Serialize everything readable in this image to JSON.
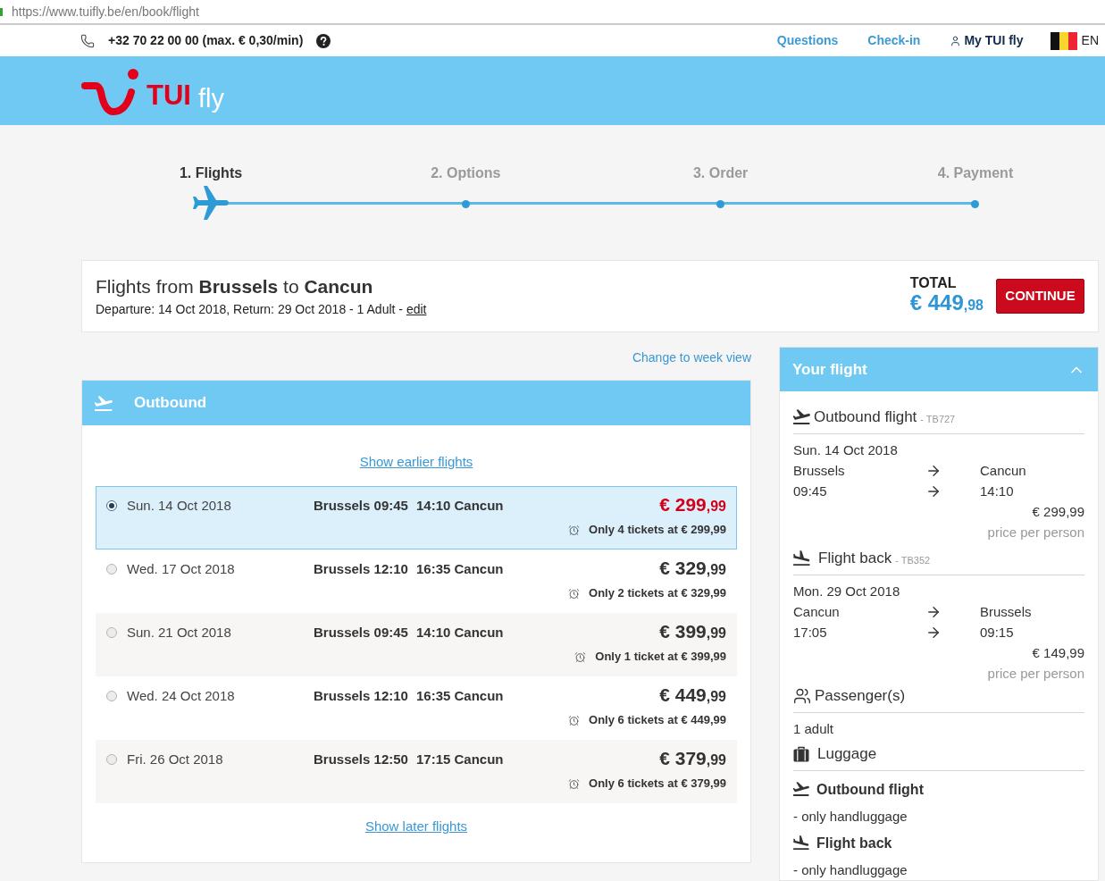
{
  "browser": {
    "url": "https://www.tuifly.be/en/book/flight"
  },
  "top_bar": {
    "phone": "+32 70 22 00 00 (max. € 0,30/min)",
    "links": [
      {
        "kind": "link",
        "label": "Questions"
      },
      {
        "kind": "link",
        "label": "Check-in"
      },
      {
        "kind": "account",
        "label": "My TUI fly"
      }
    ],
    "language": "EN"
  },
  "logo": {
    "brand": "TUI",
    "product": "fly"
  },
  "steps": [
    {
      "label": "1. Flights",
      "selected": true
    },
    {
      "label": "2. Options",
      "selected": false
    },
    {
      "label": "3. Order",
      "selected": false
    },
    {
      "label": "4. Payment",
      "selected": false
    }
  ],
  "summary": {
    "title": "Flights from **Brussels** to **Cancun**",
    "details": "Departure: 14 Oct 2018, Return: 29 Oct 2018 - 1 Adult -",
    "edit_link": "edit",
    "total_label": "TOTAL",
    "total": {
      "amount": "€ 449",
      "cents": ",98"
    },
    "continue_button": "CONTINUE"
  },
  "week_view_link": "Change to week view",
  "outbound": {
    "title": "Outbound",
    "earlier_link": "Show earlier flights",
    "flights": [
      {
        "date": "Sun. 14 Oct 2018",
        "departure": "Brussels 09:45",
        "arrival": "14:10 Cancun",
        "price": {
          "amount": "€ 299",
          "cents": ",99"
        },
        "availability": "Only 4 tickets at € 299,99",
        "selected": true
      },
      {
        "date": "Wed. 17 Oct 2018",
        "departure": "Brussels 12:10",
        "arrival": "16:35 Cancun",
        "price": {
          "amount": "€ 329",
          "cents": ",99"
        },
        "availability": "Only 2 tickets at € 329,99",
        "selected": false
      },
      {
        "date": "Sun. 21 Oct 2018",
        "departure": "Brussels 09:45",
        "arrival": "14:10 Cancun",
        "price": {
          "amount": "€ 399",
          "cents": ",99"
        },
        "availability": "Only 1 ticket at € 399,99",
        "selected": false
      },
      {
        "date": "Wed. 24 Oct 2018",
        "departure": "Brussels 12:10",
        "arrival": "16:35 Cancun",
        "price": {
          "amount": "€ 449",
          "cents": ",99"
        },
        "availability": "Only 6 tickets at € 449,99",
        "selected": false
      },
      {
        "date": "Fri. 26 Oct 2018",
        "departure": "Brussels 12:50",
        "arrival": "17:15 Cancun",
        "price": {
          "amount": "€ 379",
          "cents": ",99"
        },
        "availability": "Only 6 tickets at € 379,99",
        "selected": false
      }
    ],
    "later_link": "Show later flights"
  },
  "your_flight": {
    "title": "Your flight",
    "expanded": true,
    "legs": [
      {
        "kind": "departure",
        "title": "Outbound flight",
        "code": "- TB727",
        "date": "Sun. 14 Oct 2018",
        "from": "Brussels",
        "to": "Cancun",
        "departure_time": "09:45",
        "arrival_time": "14:10",
        "price": "€ 299,99",
        "price_note": "price per person"
      },
      {
        "kind": "arrival",
        "title": "Flight back",
        "code": "- TB352",
        "date": "Mon. 29 Oct 2018",
        "from": "Cancun",
        "to": "Brussels",
        "departure_time": "17:05",
        "arrival_time": "09:15",
        "price": "€ 149,99",
        "price_note": "price per person"
      }
    ],
    "passengers": {
      "title": "Passenger(s)",
      "value": "1 adult"
    },
    "luggage": {
      "title": "Luggage",
      "items": [
        {
          "kind": "departure",
          "title": "Outbound flight",
          "note": "- only handluggage"
        },
        {
          "kind": "arrival",
          "title": "Flight back",
          "note": "- only handluggage"
        }
      ]
    }
  }
}
